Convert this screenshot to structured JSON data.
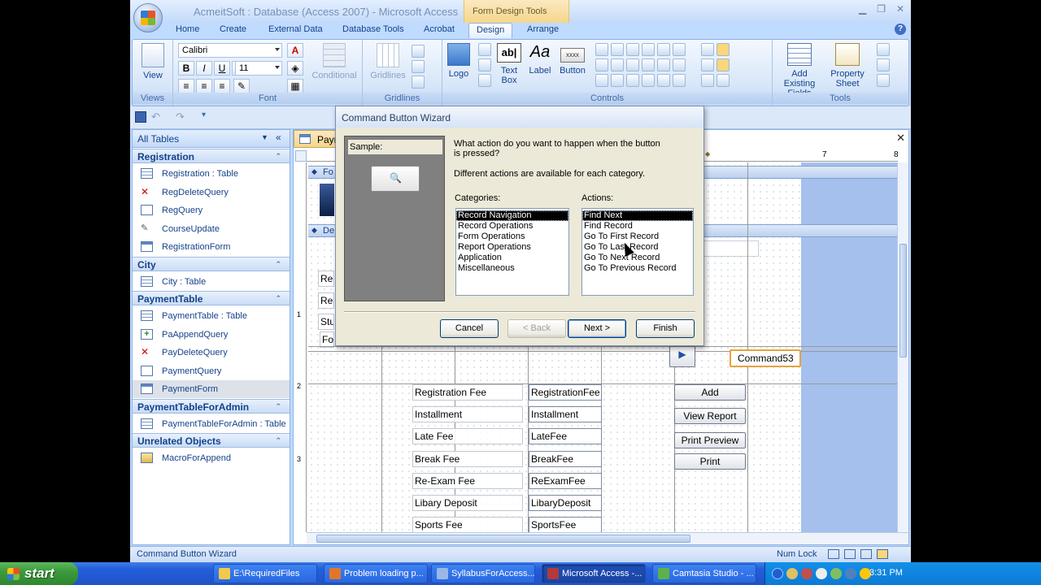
{
  "window": {
    "title": "AcmeitSoft : Database (Access 2007) - Microsoft Access",
    "context_tab": "Form Design Tools"
  },
  "ribbon": {
    "tabs": [
      "Home",
      "Create",
      "External Data",
      "Database Tools",
      "Acrobat",
      "Design",
      "Arrange"
    ],
    "active_tab": "Design",
    "views": {
      "view_label": "View",
      "group_label": "Views"
    },
    "font": {
      "font_name": "Calibri",
      "font_size": "11",
      "bold": "B",
      "italic": "I",
      "underline": "U",
      "conditional": "Conditional",
      "group_label": "Font"
    },
    "gridlines": {
      "gridlines_label": "Gridlines",
      "group_label": "Gridlines"
    },
    "controls": {
      "logo": "Logo",
      "text_box": "Text Box",
      "label": "Label",
      "button": "Button",
      "button_sample": "xxxx",
      "group_label": "Controls"
    },
    "tools": {
      "add_existing_fields": "Add Existing Fields",
      "property_sheet": "Property Sheet",
      "group_label": "Tools"
    }
  },
  "navigation": {
    "header": "All Tables",
    "groups": [
      {
        "name": "Registration",
        "items": [
          "Registration : Table",
          "RegDeleteQuery",
          "RegQuery",
          "CourseUpdate",
          "RegistrationForm"
        ]
      },
      {
        "name": "City",
        "items": [
          "City : Table"
        ]
      },
      {
        "name": "PaymentTable",
        "items": [
          "PaymentTable : Table",
          "PaAppendQuery",
          "PayDeleteQuery",
          "PaymentQuery",
          "PaymentForm"
        ]
      },
      {
        "name": "PaymentTableForAdmin",
        "items": [
          "PaymentTableForAdmin : Table"
        ]
      },
      {
        "name": "Unrelated Objects",
        "items": [
          "MacroForAppend"
        ]
      }
    ],
    "selected_item": "PaymentForm"
  },
  "document": {
    "tab_label": "Payr",
    "section_form_header": "Fo",
    "section_detail": "De",
    "partial_labels": [
      "Reg",
      "Reg",
      "Stu",
      "Fo"
    ],
    "next_arrow": "▶",
    "command53": "Command53",
    "rows": [
      {
        "label": "Registration Fee",
        "field": "RegistrationFee"
      },
      {
        "label": "Installment",
        "field": "Installment"
      },
      {
        "label": "Late Fee",
        "field": "LateFee"
      },
      {
        "label": "Break Fee",
        "field": "BreakFee"
      },
      {
        "label": "Re-Exam Fee",
        "field": "ReExamFee"
      },
      {
        "label": "Libary Deposit",
        "field": "LibaryDeposit"
      },
      {
        "label": "Sports Fee",
        "field": "SportsFee"
      }
    ],
    "buttons": [
      "Add",
      "View Report",
      "Print Preview",
      "Print"
    ],
    "ruler_marks": [
      "7",
      "8"
    ],
    "vruler_marks": [
      "1",
      "2",
      "3"
    ]
  },
  "dialog": {
    "title": "Command Button Wizard",
    "sample_label": "Sample:",
    "question": "What action do you want to happen when the button is pressed?",
    "hint": "Different actions are available for each category.",
    "categories_label": "Categories:",
    "categories": [
      "Record Navigation",
      "Record Operations",
      "Form Operations",
      "Report Operations",
      "Application",
      "Miscellaneous"
    ],
    "actions_label": "Actions:",
    "actions": [
      "Find Next",
      "Find Record",
      "Go To First Record",
      "Go To Last Record",
      "Go To Next Record",
      "Go To Previous Record"
    ],
    "buttons": {
      "cancel": "Cancel",
      "back": "< Back",
      "next": "Next >",
      "finish": "Finish"
    }
  },
  "statusbar": {
    "text": "Command Button Wizard",
    "num_lock": "Num Lock"
  },
  "taskbar": {
    "start": "start",
    "items": [
      "E:\\RequiredFiles",
      "Problem loading p...",
      "SyllabusForAccess...",
      "Microsoft Access -...",
      "Camtasia Studio - ..."
    ],
    "active_item": "Microsoft Access -...",
    "clock": "3:31 PM"
  }
}
